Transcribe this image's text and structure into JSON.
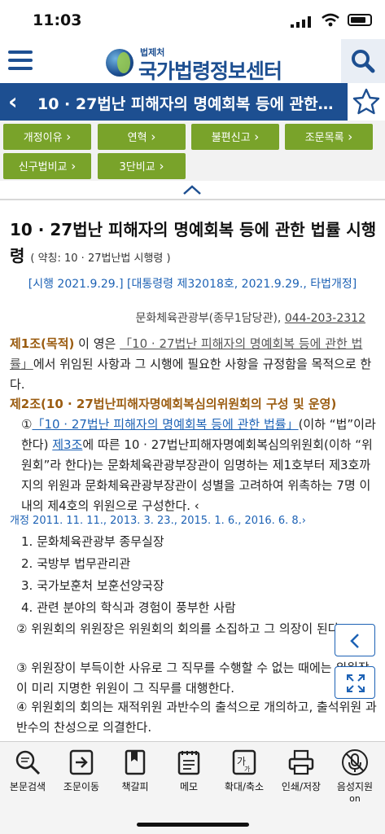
{
  "status": {
    "time": "11:03"
  },
  "header": {
    "org_small": "법제처",
    "org_name": "국가법령정보센터"
  },
  "titlebar": {
    "title": "10 · 27법난 피해자의 명예회복 등에 관한…"
  },
  "tabs": [
    {
      "label": "개정이유"
    },
    {
      "label": "연혁"
    },
    {
      "label": "불편신고"
    },
    {
      "label": "조문목록"
    },
    {
      "label": "신구법비교"
    },
    {
      "label": "3단비교"
    }
  ],
  "law": {
    "title": "10 · 27법난 피해자의 명예회복 등에 관한 법률 시행령",
    "abbr": "( 약칭: 10 · 27법난법 시행령 )",
    "enforce": "[시행 2021.9.29.] [대통령령 제32018호, 2021.9.29., 타법개정]",
    "ministry": "문화체육관광부(종무1담당관),",
    "phone": "044-203-2312"
  },
  "article1": {
    "head": "제1조(목적)",
    "pre": " 이 영은 ",
    "link": "「10 · 27법난 피해자의 명예회복 등에 관한 법률」",
    "post": "에서 위임된 사항과 그 시행에 필요한 사항을 규정함을 목적으로 한다."
  },
  "article2": {
    "head": "제2조(10 · 27법난피해자명예회복심의위원회의 구성 및 운영)",
    "p1_mark": "①",
    "p1_link": "「10 · 27법난 피해자의 명예회복 등에 관한 법률」",
    "p1_a": "(이하 “법”이라 한다) ",
    "p1_ref": "제3조",
    "p1_b": "에 따른 10 · 27법난피해자명예회복심의위원회(이하 “위원회”라 한다)는 문화체육관광부장관이 임명하는 제1호부터 제3호까지의 위원과 문화체육관광부장관이 성별을 고려하여 위촉하는 7명 이내의 제4호의 위원으로 구성한다. ‹",
    "revision": "개정 2011. 11. 11., 2013. 3. 23., 2015. 1. 6., 2016. 6. 8.›",
    "items": [
      "1. 문화체육관광부 종무실장",
      "2. 국방부 법무관리관",
      "3. 국가보훈처 보훈선양국장",
      "4. 관련 분야의 학식과 경험이 풍부한 사람"
    ],
    "p2": "② 위원회의 위원장은 위원회의 회의를 소집하고 그 의장이 된다.",
    "p3": "③ 위원장이 부득이한 사유로 그 직무를 수행할 수 없는 때에는 위원장이 미리 지명한 위원이 그 직무를 대행한다.",
    "p4": "④ 위원회의 회의는 재적위원 과반수의 출석으로 개의하고, 출석위원 과반수의 찬성으로 의결한다."
  },
  "toolbar": [
    {
      "label": "본문검색",
      "icon": "magnifier-icon"
    },
    {
      "label": "조문이동",
      "icon": "jump-arrow-icon"
    },
    {
      "label": "책갈피",
      "icon": "bookmark-icon"
    },
    {
      "label": "메모",
      "icon": "memo-icon"
    },
    {
      "label": "확대/축소",
      "icon": "zoom-text-icon"
    },
    {
      "label": "인쇄/저장",
      "icon": "printer-icon"
    },
    {
      "label": "음성지원",
      "sub": "on",
      "icon": "mic-muted-icon"
    }
  ],
  "colors": {
    "brand": "#1d4f91",
    "button_green": "#79a32a",
    "article_head": "#9b5d12",
    "link": "#1d62b5"
  }
}
